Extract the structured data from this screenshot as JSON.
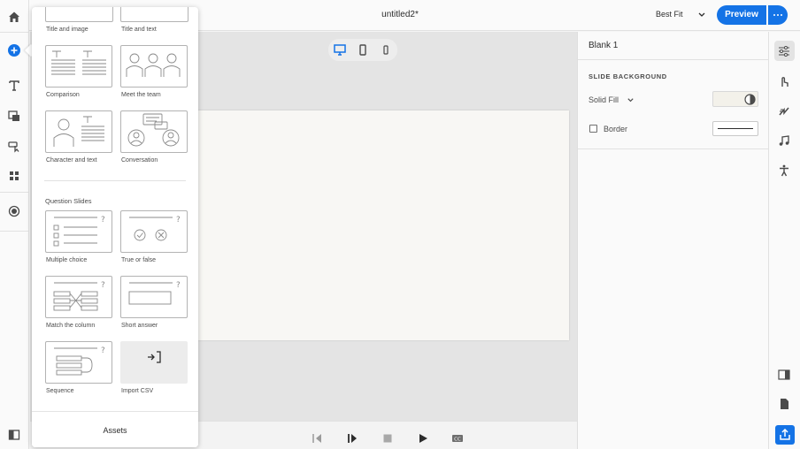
{
  "document": {
    "title": "untitled2*"
  },
  "toolbar": {
    "zoom": "Best Fit",
    "preview_label": "Preview"
  },
  "leftrail": {
    "icons": [
      "home-icon",
      "add-icon",
      "text-icon",
      "media-icon",
      "interaction-icon",
      "widgets-icon",
      "record-icon",
      "slides-panel-icon"
    ]
  },
  "device_views": [
    "desktop",
    "tablet",
    "mobile"
  ],
  "popover": {
    "partial_tiles": [
      {
        "label": "Title and image"
      },
      {
        "label": "Title and text"
      }
    ],
    "layout_tiles": [
      {
        "label": "Comparison",
        "icon": "comparison-layout-icon"
      },
      {
        "label": "Meet the team",
        "icon": "meet-the-team-layout-icon"
      },
      {
        "label": "Character and text",
        "icon": "character-and-text-layout-icon"
      },
      {
        "label": "Conversation",
        "icon": "conversation-layout-icon"
      }
    ],
    "question_section": "Question Slides",
    "question_tiles": [
      {
        "label": "Multiple choice",
        "icon": "multiple-choice-icon"
      },
      {
        "label": "True or false",
        "icon": "true-or-false-icon"
      },
      {
        "label": "Match the column",
        "icon": "match-the-column-icon"
      },
      {
        "label": "Short answer",
        "icon": "short-answer-icon"
      },
      {
        "label": "Sequence",
        "icon": "sequence-icon"
      },
      {
        "label": "Import CSV",
        "icon": "import-icon"
      }
    ],
    "assets_label": "Assets"
  },
  "properties": {
    "slide_name": "Blank 1",
    "section": "SLIDE BACKGROUND",
    "fill_type": "Solid Fill",
    "border_label": "Border",
    "border_checked": false,
    "fill_color": "#f3f1ea"
  },
  "playbar": {
    "icons": [
      "previous-icon",
      "play-pause-icon",
      "stop-icon",
      "play-icon",
      "closed-captions-icon"
    ]
  },
  "rightrail": {
    "icons": [
      "properties-icon",
      "interactions-icon",
      "animation-icon",
      "audio-icon",
      "accessibility-icon",
      "slide-notes-icon",
      "document-icon",
      "export-icon"
    ]
  },
  "colors": {
    "accent": "#1473e6",
    "canvas": "#e4e4e4",
    "slide": "#f8f7f4"
  }
}
